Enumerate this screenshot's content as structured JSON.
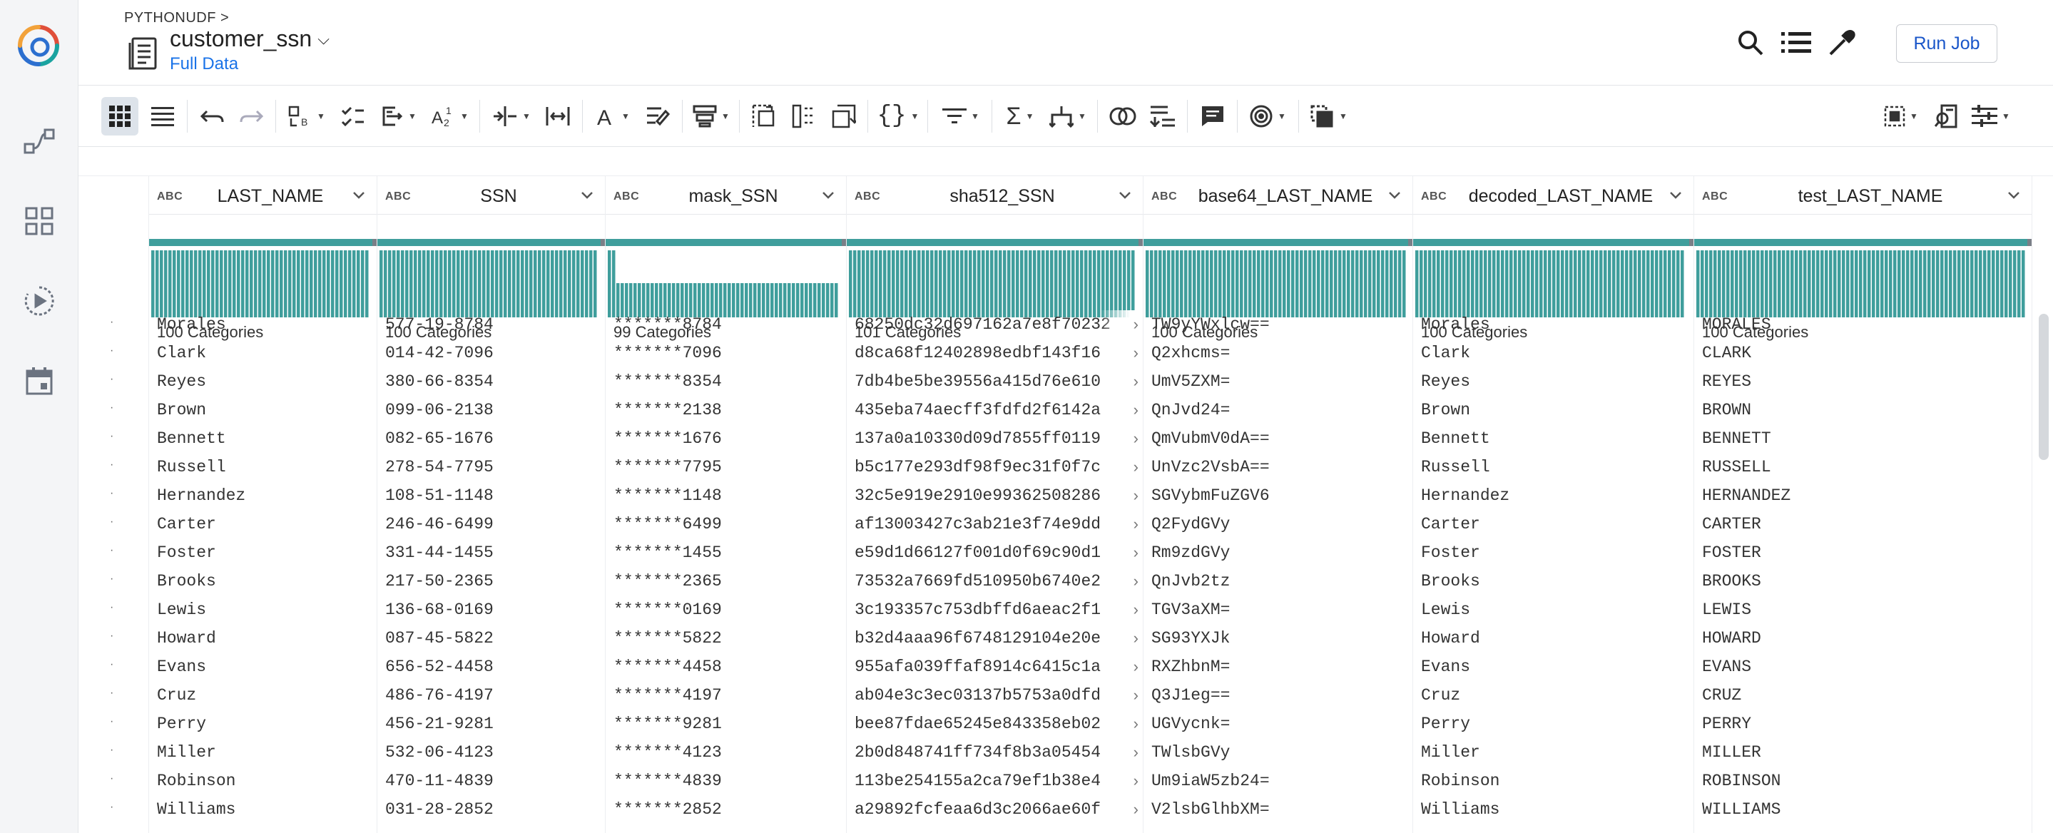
{
  "header": {
    "breadcrumb": "PYTHONUDF >",
    "title": "customer_ssn",
    "subtitle": "Full Data",
    "run_job_label": "Run Job"
  },
  "icons": {
    "rail": [
      "logo-icon",
      "flow-icon",
      "dashboard-icon",
      "play-circle-icon",
      "calendar-icon"
    ],
    "header": [
      "search-icon",
      "list-icon",
      "eyedropper-icon"
    ]
  },
  "colors": {
    "accent": "#1a73e8",
    "quality_bar": "#3f9e9c",
    "histogram": "#3f9e9c"
  },
  "columns": [
    {
      "type": "ABC",
      "name": "LAST_NAME",
      "categories": "100 Categories"
    },
    {
      "type": "ABC",
      "name": "SSN",
      "categories": "100 Categories"
    },
    {
      "type": "ABC",
      "name": "mask_SSN",
      "categories": "99 Categories"
    },
    {
      "type": "ABC",
      "name": "sha512_SSN",
      "categories": "101 Categories"
    },
    {
      "type": "ABC",
      "name": "base64_LAST_NAME",
      "categories": "100 Categories"
    },
    {
      "type": "ABC",
      "name": "decoded_LAST_NAME",
      "categories": "100 Categories"
    },
    {
      "type": "ABC",
      "name": "test_LAST_NAME",
      "categories": "100 Categories"
    }
  ],
  "rows": [
    [
      "Morales",
      "577-19-8784",
      "*******8784",
      "68250dc32d697162a7e8f70232",
      "TW9yYWxlcw==",
      "Morales",
      "MORALES"
    ],
    [
      "Clark",
      "014-42-7096",
      "*******7096",
      "d8ca68f12402898edbf143f16",
      "Q2xhcms=",
      "Clark",
      "CLARK"
    ],
    [
      "Reyes",
      "380-66-8354",
      "*******8354",
      "7db4be5be39556a415d76e610",
      "UmV5ZXM=",
      "Reyes",
      "REYES"
    ],
    [
      "Brown",
      "099-06-2138",
      "*******2138",
      "435eba74aecff3fdfd2f6142a",
      "QnJvd24=",
      "Brown",
      "BROWN"
    ],
    [
      "Bennett",
      "082-65-1676",
      "*******1676",
      "137a0a10330d09d7855ff0119",
      "QmVubmV0dA==",
      "Bennett",
      "BENNETT"
    ],
    [
      "Russell",
      "278-54-7795",
      "*******7795",
      "b5c177e293df98f9ec31f0f7c",
      "UnVzc2VsbA==",
      "Russell",
      "RUSSELL"
    ],
    [
      "Hernandez",
      "108-51-1148",
      "*******1148",
      "32c5e919e2910e99362508286",
      "SGVybmFuZGV6",
      "Hernandez",
      "HERNANDEZ"
    ],
    [
      "Carter",
      "246-46-6499",
      "*******6499",
      "af13003427c3ab21e3f74e9dd",
      "Q2FydGVy",
      "Carter",
      "CARTER"
    ],
    [
      "Foster",
      "331-44-1455",
      "*******1455",
      "e59d1d66127f001d0f69c90d1",
      "Rm9zdGVy",
      "Foster",
      "FOSTER"
    ],
    [
      "Brooks",
      "217-50-2365",
      "*******2365",
      "73532a7669fd510950b6740e2",
      "QnJvb2tz",
      "Brooks",
      "BROOKS"
    ],
    [
      "Lewis",
      "136-68-0169",
      "*******0169",
      "3c193357c753dbffd6aeac2f1",
      "TGV3aXM=",
      "Lewis",
      "LEWIS"
    ],
    [
      "Howard",
      "087-45-5822",
      "*******5822",
      "b32d4aaa96f6748129104e20e",
      "SG93YXJk",
      "Howard",
      "HOWARD"
    ],
    [
      "Evans",
      "656-52-4458",
      "*******4458",
      "955afa039ffaf8914c6415c1a",
      "RXZhbnM=",
      "Evans",
      "EVANS"
    ],
    [
      "Cruz",
      "486-76-4197",
      "*******4197",
      "ab04e3c3ec03137b5753a0dfd",
      "Q3J1eg==",
      "Cruz",
      "CRUZ"
    ],
    [
      "Perry",
      "456-21-9281",
      "*******9281",
      "bee87fdae65245e843358eb02",
      "UGVycnk=",
      "Perry",
      "PERRY"
    ],
    [
      "Miller",
      "532-06-4123",
      "*******4123",
      "2b0d848741ff734f8b3a05454",
      "TWlsbGVy",
      "Miller",
      "MILLER"
    ],
    [
      "Robinson",
      "470-11-4839",
      "*******4839",
      "113be254155a2ca79ef1b38e4",
      "Um9iaW5zb24=",
      "Robinson",
      "ROBINSON"
    ],
    [
      "Williams",
      "031-28-2852",
      "*******2852",
      "a29892fcfeaa6d3c2066ae60f",
      "V2lsbGlhbXM=",
      "Williams",
      "WILLIAMS"
    ]
  ]
}
